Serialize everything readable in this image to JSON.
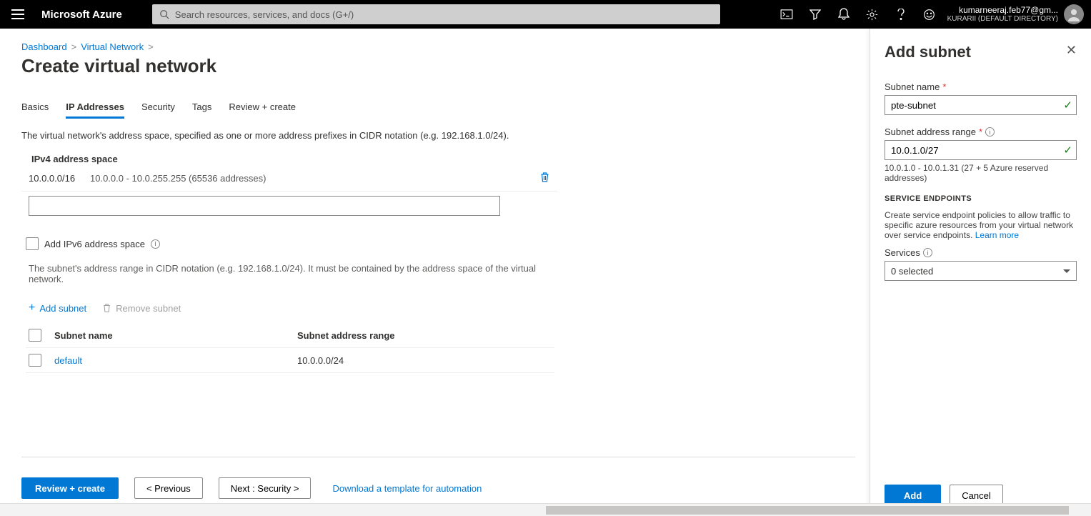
{
  "header": {
    "brand": "Microsoft Azure",
    "search_placeholder": "Search resources, services, and docs (G+/)",
    "user_email": "kumarneeraj.feb77@gm...",
    "user_directory": "KURARII (DEFAULT DIRECTORY)"
  },
  "breadcrumb": {
    "items": [
      "Dashboard",
      "Virtual Network"
    ],
    "sep": ">"
  },
  "page_title": "Create virtual network",
  "tabs": [
    {
      "label": "Basics"
    },
    {
      "label": "IP Addresses",
      "active": true
    },
    {
      "label": "Security"
    },
    {
      "label": "Tags"
    },
    {
      "label": "Review + create"
    }
  ],
  "ip": {
    "help": "The virtual network's address space, specified as one or more address prefixes in CIDR notation (e.g. 192.168.1.0/24).",
    "section_label": "IPv4 address space",
    "row": {
      "cidr": "10.0.0.0/16",
      "desc": "10.0.0.0 - 10.0.255.255 (65536 addresses)"
    },
    "ipv6_label": "Add IPv6 address space",
    "subnet_help": "The subnet's address range in CIDR notation (e.g. 192.168.1.0/24). It must be contained by the address space of the virtual network.",
    "add_subnet": "Add subnet",
    "remove_subnet": "Remove subnet",
    "cols": {
      "name": "Subnet name",
      "range": "Subnet address range"
    },
    "rows": [
      {
        "name": "default",
        "range": "10.0.0.0/24"
      }
    ]
  },
  "footer": {
    "review": "Review + create",
    "previous": "< Previous",
    "next": "Next : Security >",
    "download": "Download a template for automation"
  },
  "panel": {
    "title": "Add subnet",
    "name_label": "Subnet name",
    "name_value": "pte-subnet",
    "range_label": "Subnet address range",
    "range_value": "10.0.1.0/27",
    "range_hint": "10.0.1.0 - 10.0.1.31 (27 + 5 Azure reserved addresses)",
    "endpoints_head": "SERVICE ENDPOINTS",
    "endpoints_text": "Create service endpoint policies to allow traffic to specific azure resources from your virtual network over service endpoints. ",
    "endpoints_link": "Learn more",
    "services_label": "Services",
    "services_value": "0 selected",
    "add": "Add",
    "cancel": "Cancel"
  }
}
